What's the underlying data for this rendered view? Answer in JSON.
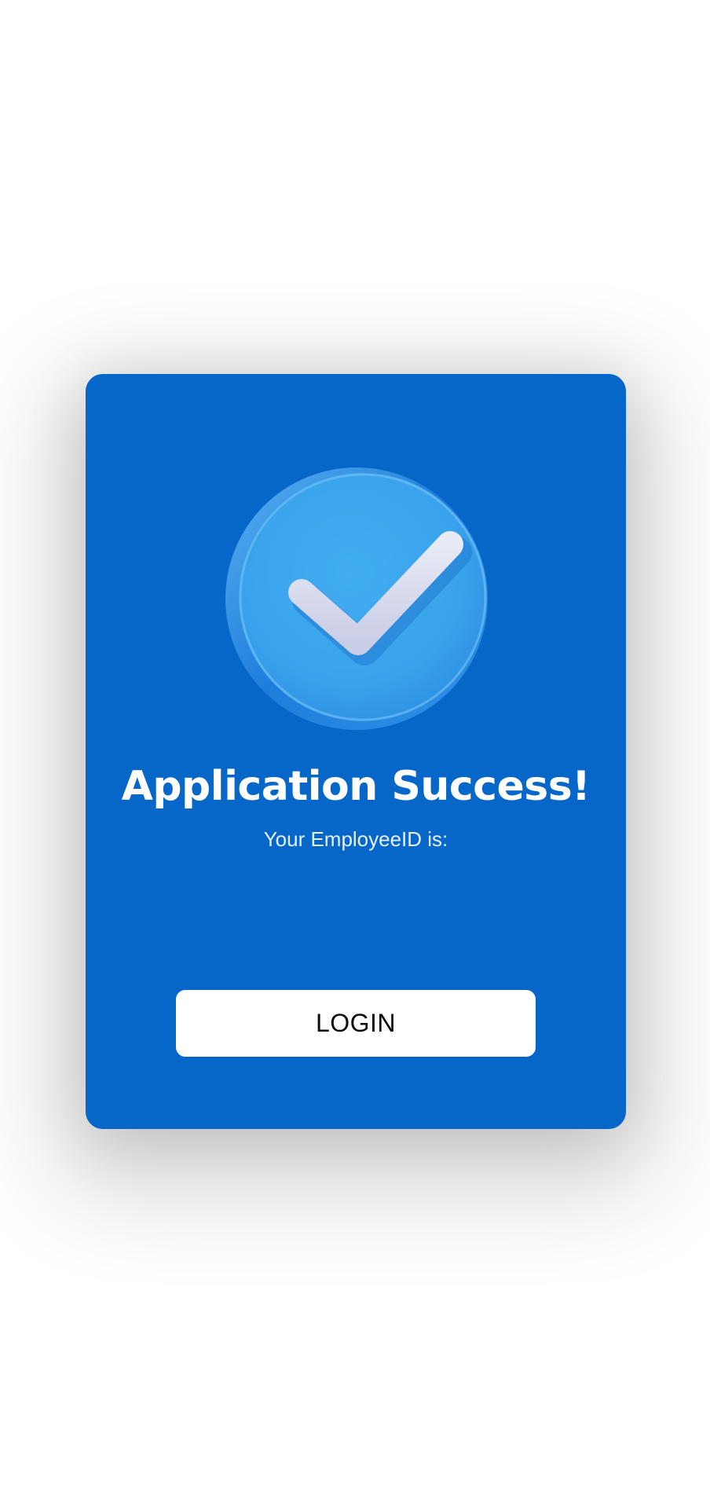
{
  "card": {
    "title": "Application Success!",
    "subtitle": "Your EmployeeID is:",
    "employee_id": "",
    "login_label": "LOGIN"
  },
  "icons": {
    "badge": "check-circle-icon"
  },
  "colors": {
    "card_background": "#0667c9",
    "badge_face": "#38a2ec",
    "badge_rim": "#1b77d8",
    "checkmark": "#d8dbee",
    "button_background": "#ffffff",
    "button_text": "#0b0b0b",
    "text": "#ffffff"
  }
}
